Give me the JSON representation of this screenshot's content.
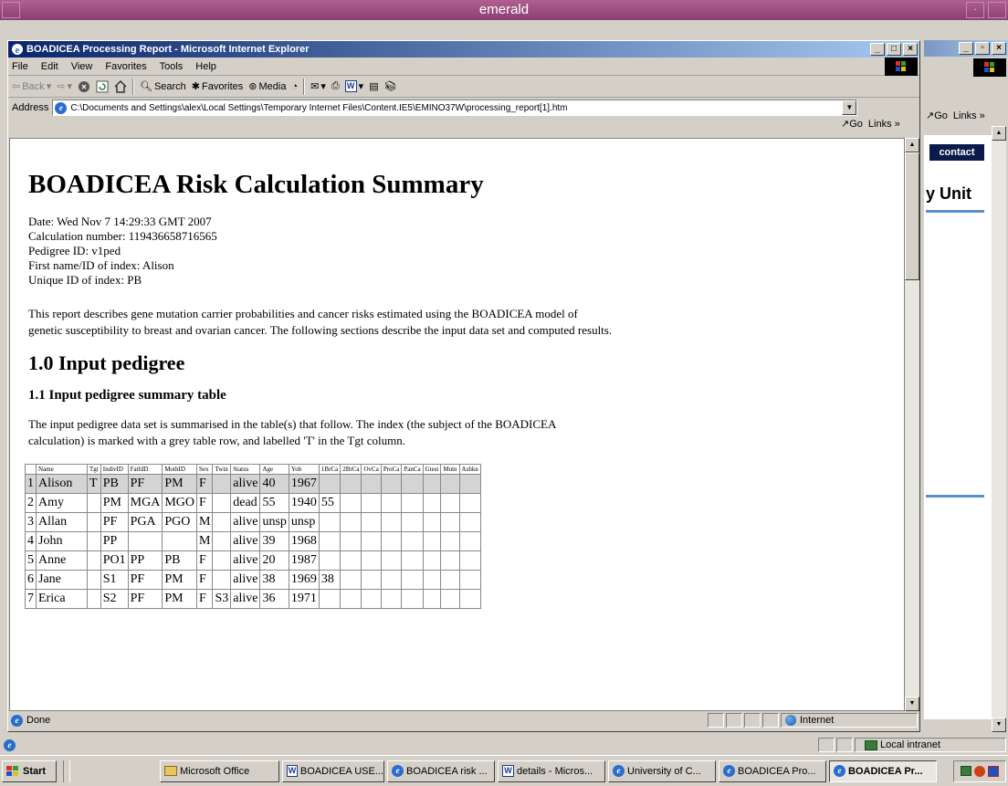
{
  "outer_window": {
    "title": "emerald"
  },
  "ie_window": {
    "title": "BOADICEA Processing Report - Microsoft Internet Explorer",
    "menu": [
      "File",
      "Edit",
      "View",
      "Favorites",
      "Tools",
      "Help"
    ],
    "toolbar": {
      "back": "Back",
      "search": "Search",
      "favorites": "Favorites",
      "media": "Media"
    },
    "address": {
      "label": "Address",
      "url": "C:\\Documents and Settings\\alex\\Local Settings\\Temporary Internet Files\\Content.IE5\\EMINO37W\\processing_report[1].htm",
      "go": "Go",
      "links": "Links"
    },
    "status": {
      "text": "Done",
      "zone": "Internet"
    }
  },
  "report": {
    "title": "BOADICEA Risk Calculation Summary",
    "meta": [
      "Date: Wed Nov 7 14:29:33 GMT 2007",
      "Calculation number: 119436658716565",
      "Pedigree ID: v1ped",
      "First name/ID of index: Alison",
      "Unique ID of index: PB"
    ],
    "intro": "This report describes gene mutation carrier probabilities and cancer risks estimated using the BOADICEA model of genetic susceptibility to breast and ovarian cancer. The following sections describe the input data set and computed results.",
    "section1": "1.0 Input pedigree",
    "section11": "1.1 Input pedigree summary table",
    "table_intro": "The input pedigree data set is summarised in the table(s) that follow. The index (the subject of the BOADICEA calculation) is marked with a grey table row, and labelled 'T' in the Tgt column.",
    "table": {
      "headers": [
        "",
        "Name",
        "Tgt",
        "IndivID",
        "FathID",
        "MothID",
        "Sex",
        "Twin",
        "Status",
        "Age",
        "Yob",
        "1BrCa",
        "2BrCa",
        "OvCa",
        "ProCa",
        "PanCa",
        "Gtest",
        "Mutn",
        "Ashkn"
      ],
      "rows": [
        [
          "1",
          "Alison",
          "T",
          "PB",
          "PF",
          "PM",
          "F",
          "",
          "alive",
          "40",
          "1967",
          "",
          "",
          "",
          "",
          "",
          "",
          "",
          ""
        ],
        [
          "2",
          "Amy",
          "",
          "PM",
          "MGA",
          "MGO",
          "F",
          "",
          "dead",
          "55",
          "1940",
          "55",
          "",
          "",
          "",
          "",
          "",
          "",
          ""
        ],
        [
          "3",
          "Allan",
          "",
          "PF",
          "PGA",
          "PGO",
          "M",
          "",
          "alive",
          "unsp",
          "unsp",
          "",
          "",
          "",
          "",
          "",
          "",
          "",
          ""
        ],
        [
          "4",
          "John",
          "",
          "PP",
          "",
          "",
          "M",
          "",
          "alive",
          "39",
          "1968",
          "",
          "",
          "",
          "",
          "",
          "",
          "",
          ""
        ],
        [
          "5",
          "Anne",
          "",
          "PO1",
          "PP",
          "PB",
          "F",
          "",
          "alive",
          "20",
          "1987",
          "",
          "",
          "",
          "",
          "",
          "",
          "",
          ""
        ],
        [
          "6",
          "Jane",
          "",
          "S1",
          "PF",
          "PM",
          "F",
          "",
          "alive",
          "38",
          "1969",
          "38",
          "",
          "",
          "",
          "",
          "",
          "",
          ""
        ],
        [
          "7",
          "Erica",
          "",
          "S2",
          "PF",
          "PM",
          "F",
          "S3",
          "alive",
          "36",
          "1971",
          "",
          "",
          "",
          "",
          "",
          "",
          "",
          ""
        ]
      ]
    }
  },
  "background_window": {
    "go": "Go",
    "links": "Links",
    "contact": "contact",
    "unit_text": "y Unit",
    "status_zone": "Local intranet"
  },
  "taskbar": {
    "start": "Start",
    "tasks": [
      {
        "label": "Microsoft Office",
        "icon": "folder"
      },
      {
        "label": "BOADICEA USE...",
        "icon": "word"
      },
      {
        "label": "BOADICEA risk ...",
        "icon": "ie"
      },
      {
        "label": "details - Micros...",
        "icon": "word"
      },
      {
        "label": "University of C...",
        "icon": "ie"
      },
      {
        "label": "BOADICEA Pro...",
        "icon": "ie"
      },
      {
        "label": "BOADICEA Pr...",
        "icon": "ie",
        "active": true
      }
    ]
  },
  "colors": {
    "title_active": "#0a246a",
    "outer_title": "#9a4a80",
    "face": "#d4d0c8",
    "index_row": "#d4d4d4"
  }
}
